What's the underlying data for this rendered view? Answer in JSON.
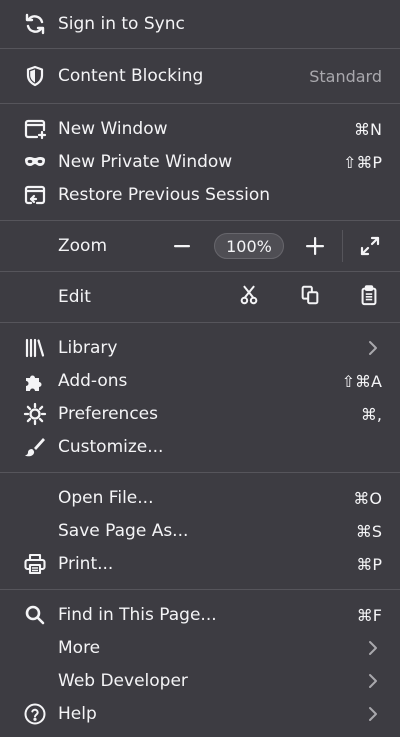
{
  "sync": {
    "label": "Sign in to Sync",
    "icon": "sync-icon"
  },
  "content_blocking": {
    "label": "Content Blocking",
    "value": "Standard",
    "icon": "shield-icon"
  },
  "new_window": {
    "label": "New Window",
    "shortcut": "⌘N",
    "icon": "new-window-icon"
  },
  "new_private_window": {
    "label": "New Private Window",
    "shortcut": "⇧⌘P",
    "icon": "mask-icon"
  },
  "restore_session": {
    "label": "Restore Previous Session",
    "icon": "restore-session-icon"
  },
  "zoom": {
    "label": "Zoom",
    "level": "100%",
    "minus": "−",
    "plus": "+"
  },
  "edit": {
    "label": "Edit"
  },
  "library": {
    "label": "Library",
    "icon": "library-icon"
  },
  "addons": {
    "label": "Add-ons",
    "shortcut": "⇧⌘A",
    "icon": "puzzle-icon"
  },
  "preferences": {
    "label": "Preferences",
    "shortcut": "⌘,",
    "icon": "gear-icon"
  },
  "customize": {
    "label": "Customize...",
    "icon": "brush-icon"
  },
  "open_file": {
    "label": "Open File...",
    "shortcut": "⌘O"
  },
  "save_page": {
    "label": "Save Page As...",
    "shortcut": "⌘S"
  },
  "print": {
    "label": "Print...",
    "shortcut": "⌘P",
    "icon": "printer-icon"
  },
  "find": {
    "label": "Find in This Page...",
    "shortcut": "⌘F",
    "icon": "search-icon"
  },
  "more": {
    "label": "More"
  },
  "web_developer": {
    "label": "Web Developer"
  },
  "help": {
    "label": "Help",
    "icon": "help-icon"
  },
  "colors": {
    "background": "#3d3c42",
    "separator": "#56555b",
    "text": "#f4f4f6",
    "dim_text": "#a9a8ad"
  }
}
